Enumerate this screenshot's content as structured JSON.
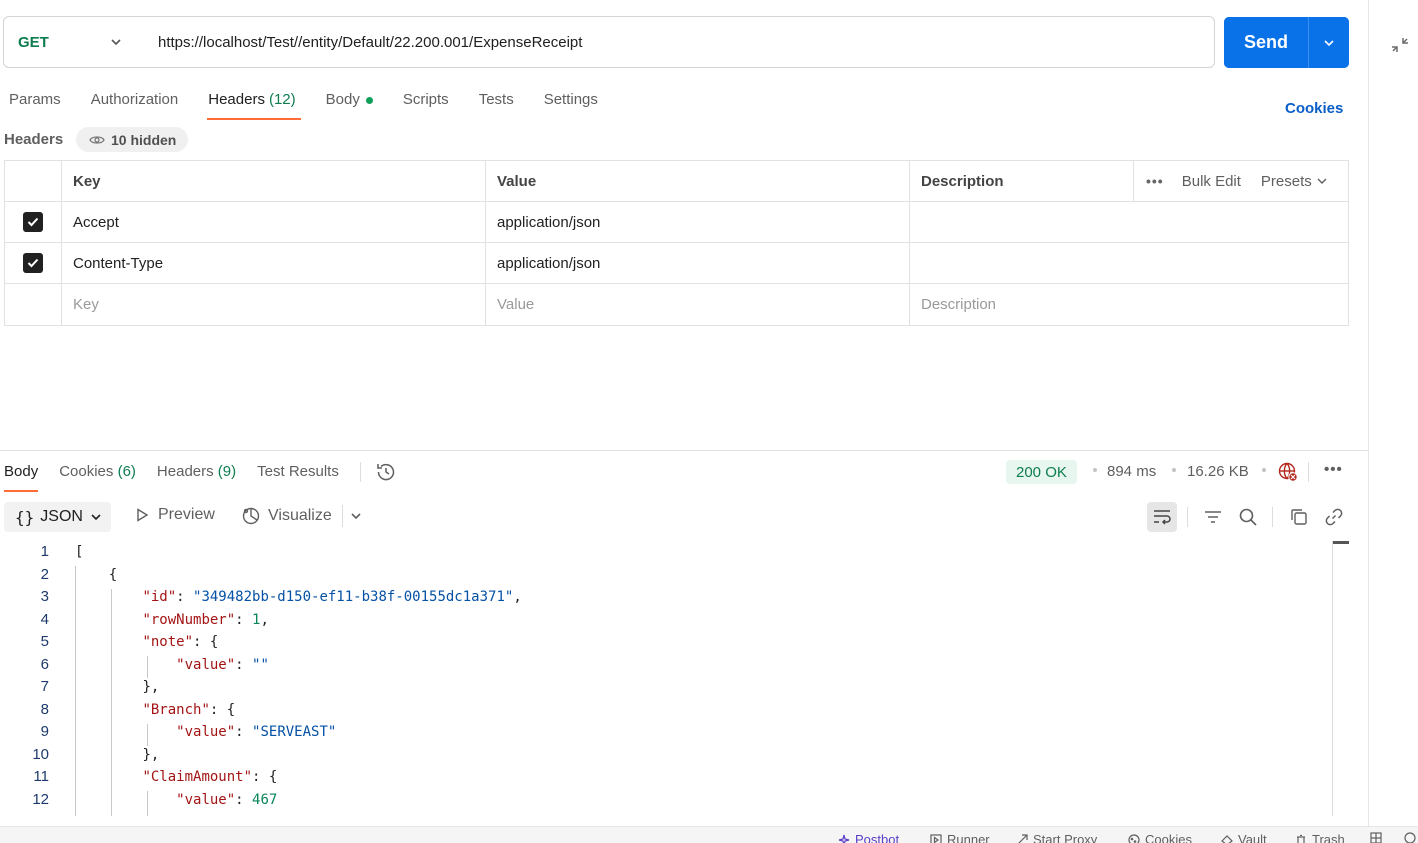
{
  "request": {
    "method": "GET",
    "url": "https://localhost/Test//entity/Default/22.200.001/ExpenseReceipt",
    "send_label": "Send"
  },
  "req_tabs": {
    "params": "Params",
    "authorization": "Authorization",
    "headers": "Headers",
    "headers_count": "(12)",
    "body": "Body",
    "scripts": "Scripts",
    "tests": "Tests",
    "settings": "Settings",
    "cookies": "Cookies"
  },
  "headers_section": {
    "label": "Headers",
    "hidden_badge": "10 hidden",
    "columns": {
      "key": "Key",
      "value": "Value",
      "description": "Description"
    },
    "actions": {
      "bulk_edit": "Bulk Edit",
      "presets": "Presets"
    },
    "rows": [
      {
        "key": "Accept",
        "value": "application/json",
        "checked": true
      },
      {
        "key": "Content-Type",
        "value": "application/json",
        "checked": true
      }
    ],
    "placeholders": {
      "key": "Key",
      "value": "Value",
      "description": "Description"
    }
  },
  "response": {
    "tabs": {
      "body": "Body",
      "cookies": "Cookies",
      "cookies_count": "(6)",
      "headers": "Headers",
      "headers_count": "(9)",
      "test_results": "Test Results"
    },
    "status": "200 OK",
    "time": "894 ms",
    "size": "16.26 KB",
    "format": "JSON",
    "preview": "Preview",
    "visualize": "Visualize"
  },
  "code_lines": [
    "1",
    "2",
    "3",
    "4",
    "5",
    "6",
    "7",
    "8",
    "9",
    "10",
    "11",
    "12"
  ],
  "code": {
    "l1": "[",
    "l2": "{",
    "l3_key": "\"id\"",
    "l3_val": "\"349482bb-d150-ef11-b38f-00155dc1a371\"",
    "l4_key": "\"rowNumber\"",
    "l4_val": "1",
    "l5_key": "\"note\"",
    "l6_key": "\"value\"",
    "l6_val": "\"\"",
    "l7": "},",
    "l8_key": "\"Branch\"",
    "l9_key": "\"value\"",
    "l9_val": "\"SERVEAST\"",
    "l10": "},",
    "l11_key": "\"ClaimAmount\"",
    "l12_key": "\"value\"",
    "l12_val": "467"
  },
  "footer": {
    "postbot": "Postbot",
    "runner": "Runner",
    "start_proxy": "Start Proxy",
    "cookies": "Cookies",
    "vault": "Vault",
    "trash": "Trash"
  },
  "colors": {
    "accent_orange": "#ff6c37",
    "send_blue": "#0a72e8",
    "method_green": "#0e7d4f",
    "status_green_bg": "#e7f6ee"
  }
}
